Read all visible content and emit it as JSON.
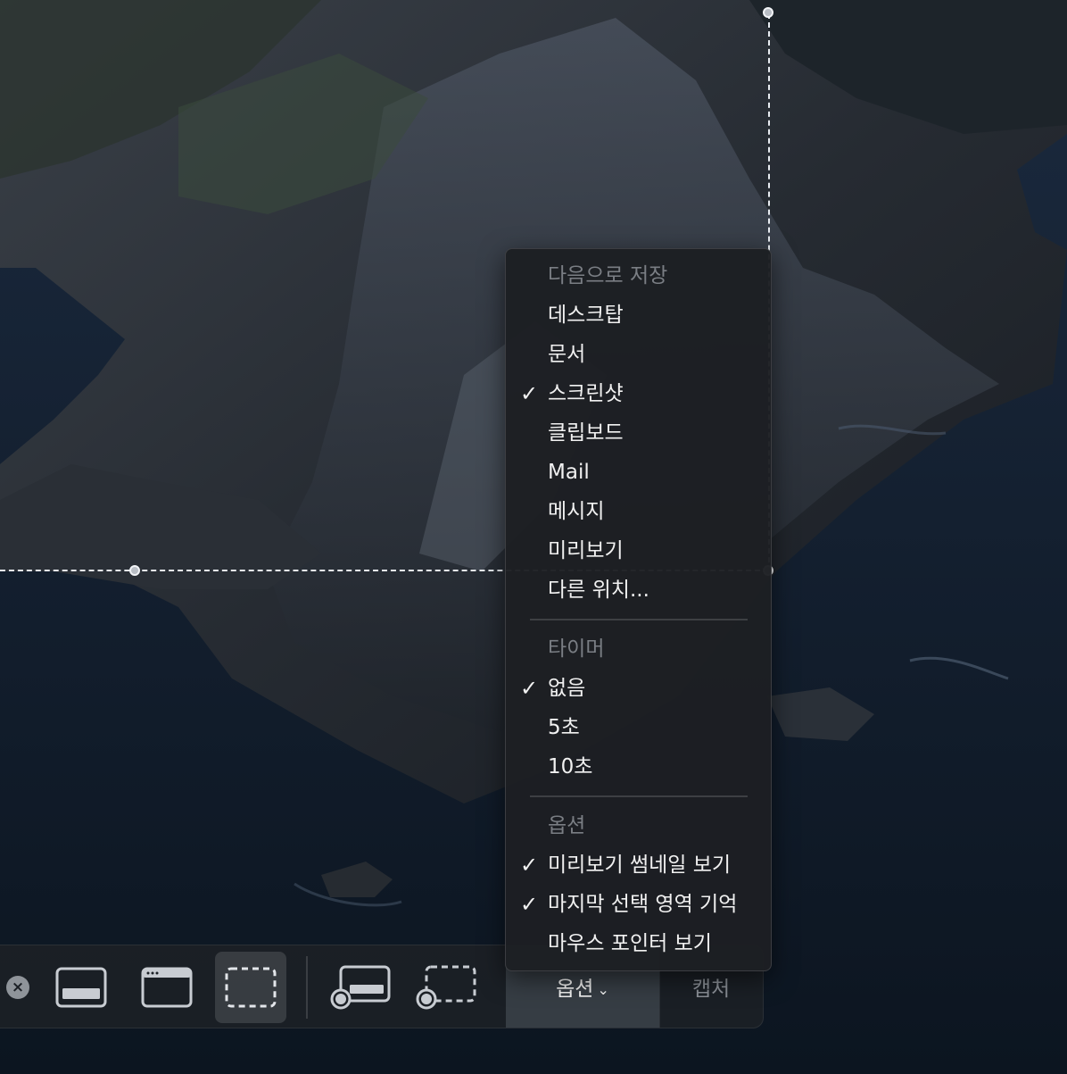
{
  "menu": {
    "sections": [
      {
        "header": "다음으로 저장",
        "items": [
          {
            "label": "데스크탑",
            "checked": false
          },
          {
            "label": "문서",
            "checked": false
          },
          {
            "label": "스크린샷",
            "checked": true
          },
          {
            "label": "클립보드",
            "checked": false
          },
          {
            "label": "Mail",
            "checked": false
          },
          {
            "label": "메시지",
            "checked": false
          },
          {
            "label": "미리보기",
            "checked": false
          },
          {
            "label": "다른 위치...",
            "checked": false
          }
        ]
      },
      {
        "header": "타이머",
        "items": [
          {
            "label": "없음",
            "checked": true
          },
          {
            "label": "5초",
            "checked": false
          },
          {
            "label": "10초",
            "checked": false
          }
        ]
      },
      {
        "header": "옵션",
        "items": [
          {
            "label": "미리보기 썸네일 보기",
            "checked": true
          },
          {
            "label": "마지막 선택 영역 기억",
            "checked": true
          },
          {
            "label": "마우스 포인터 보기",
            "checked": false
          }
        ]
      }
    ],
    "check_glyph": "✓"
  },
  "toolbar": {
    "close_icon": "×",
    "tools": [
      {
        "name": "capture-entire-screen-icon",
        "active": false
      },
      {
        "name": "capture-window-icon",
        "active": false
      },
      {
        "name": "capture-selection-icon",
        "active": true
      },
      {
        "name": "record-entire-screen-icon",
        "active": false
      },
      {
        "name": "record-selection-icon",
        "active": false
      }
    ],
    "options_label": "옵션",
    "options_chevron": "⌄",
    "capture_label": "캡처"
  },
  "colors": {
    "menu_bg": "#1d1f23",
    "menu_text": "#f1f1f1",
    "menu_header": "#7a7e84",
    "toolbar_bg": "#1c2026",
    "options_bg": "#3a4048",
    "capture_text": "#8b9097",
    "selection_line": "#e9edf2"
  }
}
